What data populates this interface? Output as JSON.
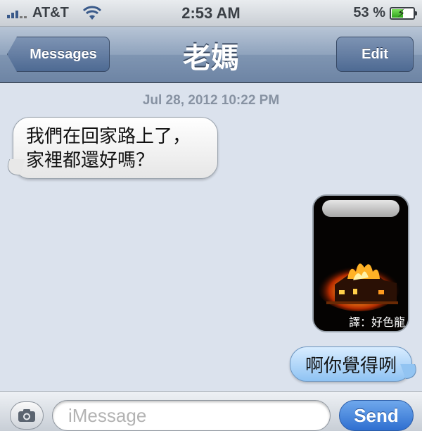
{
  "status_bar": {
    "carrier": "AT&T",
    "time": "2:53 AM",
    "battery_percent": "53 %",
    "battery_level": 0.53
  },
  "nav": {
    "back_label": "Messages",
    "title": "老媽",
    "edit_label": "Edit"
  },
  "conversation": {
    "timestamp": "Jul 28, 2012 10:22 PM",
    "incoming": {
      "line1": "我們在回家路上了，",
      "line2": "家裡都還好嗎？"
    },
    "photo_watermark": "譯：好色龍",
    "outgoing": "啊你覺得咧"
  },
  "input": {
    "placeholder": "iMessage",
    "send_label": "Send"
  }
}
